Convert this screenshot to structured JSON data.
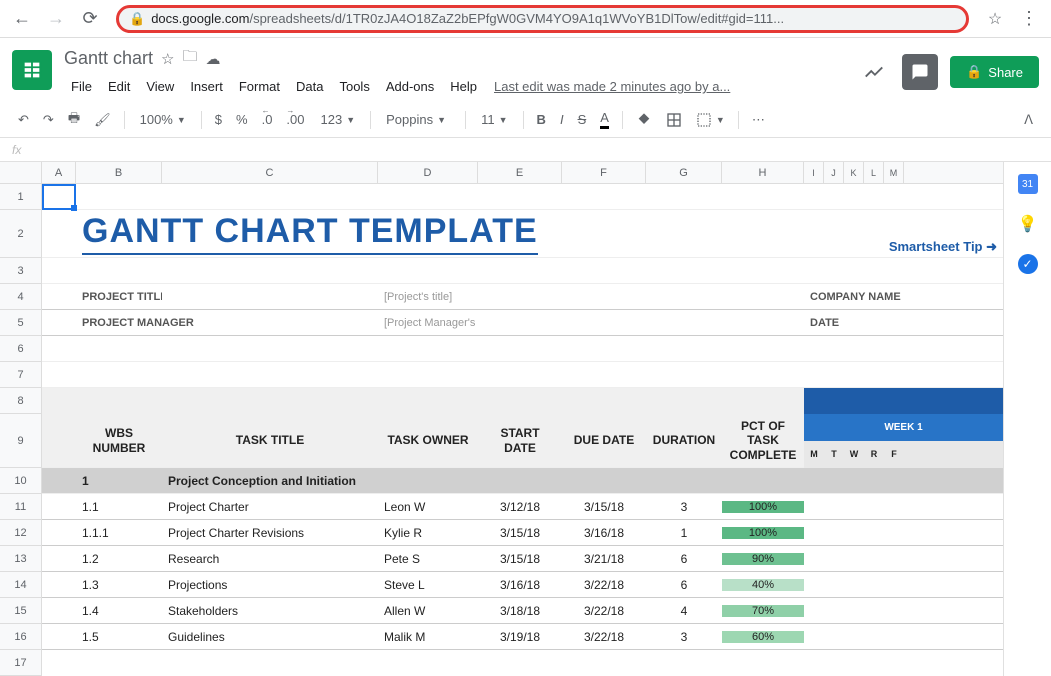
{
  "browser": {
    "url_domain": "docs.google.com",
    "url_path": "/spreadsheets/d/1TR0zJA4O18ZaZ2bEPfgW0GVM4YO9A1q1WVoYB1DlTow/edit#gid=111..."
  },
  "header": {
    "doc_title": "Gantt chart",
    "menus": [
      "File",
      "Edit",
      "View",
      "Insert",
      "Format",
      "Data",
      "Tools",
      "Add-ons",
      "Help"
    ],
    "last_edit": "Last edit was made 2 minutes ago by a...",
    "share_label": "Share"
  },
  "toolbar": {
    "zoom": "100%",
    "currency": "$",
    "percent": "%",
    "dec_dec": ".0",
    "inc_dec": ".00",
    "more_fmt": "123",
    "font": "Poppins",
    "font_size": "11",
    "bold": "B",
    "italic": "I",
    "strike": "S",
    "text_color": "A"
  },
  "formula": {
    "fx": "fx"
  },
  "columns": {
    "labels": [
      "",
      "A",
      "B",
      "C",
      "D",
      "E",
      "F",
      "G",
      "H",
      "I",
      "J",
      "K",
      "L",
      "M"
    ]
  },
  "rows": [
    1,
    2,
    3,
    4,
    5,
    6,
    7,
    8,
    9,
    10,
    11,
    12,
    13,
    14,
    15,
    16,
    17
  ],
  "content": {
    "main_title": "GANTT CHART TEMPLATE",
    "smart_tip": "Smartsheet Tip ➜",
    "project_title_label": "PROJECT TITLE",
    "project_title_ph": "[Project's title]",
    "company_name_label": "COMPANY NAME",
    "project_manager_label": "PROJECT MANAGER",
    "project_manager_ph": "[Project Manager's name]",
    "date_label": "DATE",
    "headers": {
      "wbs": "WBS NUMBER",
      "task": "TASK TITLE",
      "owner": "TASK OWNER",
      "start": "START DATE",
      "due": "DUE DATE",
      "duration": "DURATION",
      "pct": "PCT OF TASK COMPLETE",
      "week": "WEEK 1"
    },
    "days": [
      "M",
      "T",
      "W",
      "R",
      "F"
    ],
    "section": {
      "num": "1",
      "title": "Project Conception and Initiation"
    },
    "tasks": [
      {
        "wbs": "1.1",
        "title": "Project Charter",
        "owner": "Leon W",
        "start": "3/12/18",
        "due": "3/15/18",
        "dur": "3",
        "pct": "100%",
        "pct_color": "#5bb884"
      },
      {
        "wbs": "1.1.1",
        "title": "Project Charter Revisions",
        "owner": "Kylie R",
        "start": "3/15/18",
        "due": "3/16/18",
        "dur": "1",
        "pct": "100%",
        "pct_color": "#5bb884"
      },
      {
        "wbs": "1.2",
        "title": "Research",
        "owner": "Pete S",
        "start": "3/15/18",
        "due": "3/21/18",
        "dur": "6",
        "pct": "90%",
        "pct_color": "#6ec191"
      },
      {
        "wbs": "1.3",
        "title": "Projections",
        "owner": "Steve L",
        "start": "3/16/18",
        "due": "3/22/18",
        "dur": "6",
        "pct": "40%",
        "pct_color": "#b8e0c8"
      },
      {
        "wbs": "1.4",
        "title": "Stakeholders",
        "owner": "Allen W",
        "start": "3/18/18",
        "due": "3/22/18",
        "dur": "4",
        "pct": "70%",
        "pct_color": "#8fd0a8"
      },
      {
        "wbs": "1.5",
        "title": "Guidelines",
        "owner": "Malik M",
        "start": "3/19/18",
        "due": "3/22/18",
        "dur": "3",
        "pct": "60%",
        "pct_color": "#9dd7b2"
      }
    ]
  }
}
